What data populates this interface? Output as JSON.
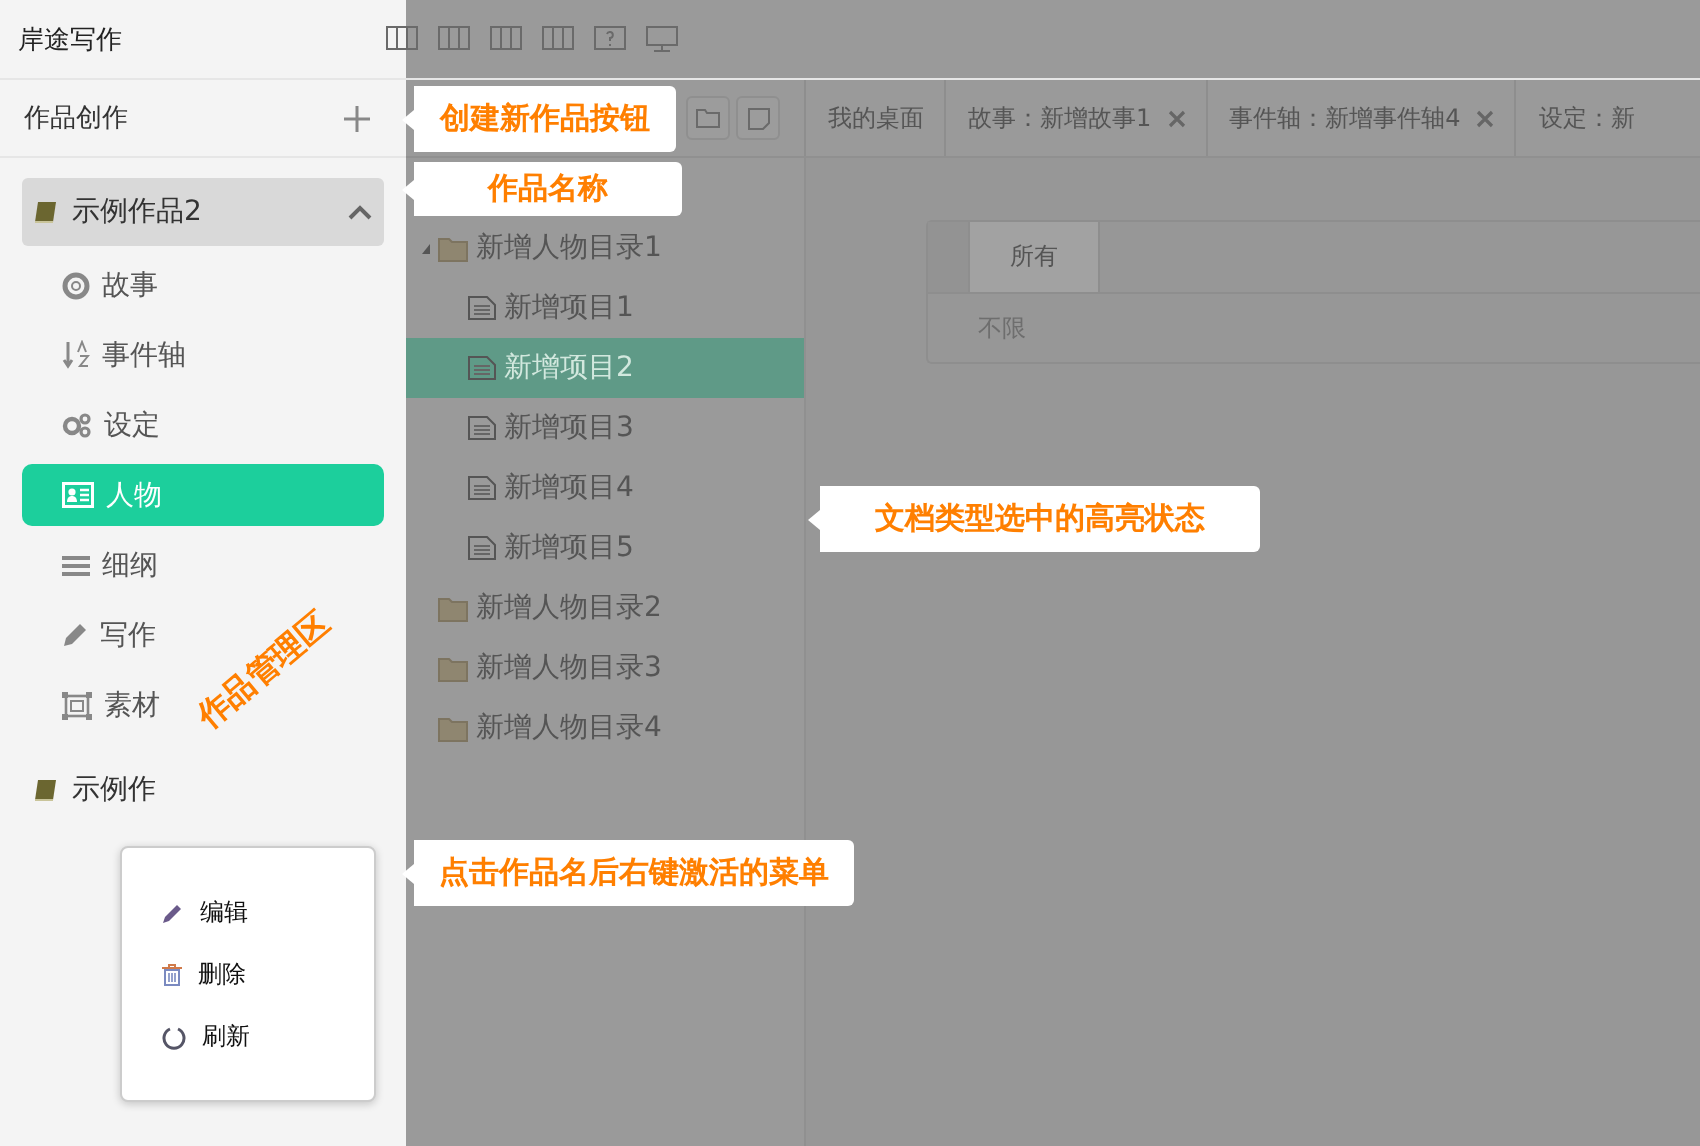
{
  "app": {
    "title": "岸途写作"
  },
  "sidebar": {
    "header": "作品创作",
    "works": [
      {
        "name": "示例作品2",
        "expanded": true,
        "doc_types": [
          {
            "label": "故事",
            "kind": "story",
            "selected": false
          },
          {
            "label": "事件轴",
            "kind": "timeline",
            "selected": false
          },
          {
            "label": "设定",
            "kind": "setting",
            "selected": false
          },
          {
            "label": "人物",
            "kind": "character",
            "selected": true
          },
          {
            "label": "细纲",
            "kind": "outline",
            "selected": false
          },
          {
            "label": "写作",
            "kind": "writing",
            "selected": false
          },
          {
            "label": "素材",
            "kind": "material",
            "selected": false
          }
        ]
      },
      {
        "name": "示例作",
        "expanded": false
      }
    ]
  },
  "tree": {
    "items": [
      {
        "label": "新增人物目录1",
        "expanded": true,
        "children": [
          {
            "label": "新增项目1",
            "selected": false
          },
          {
            "label": "新增项目2",
            "selected": true
          },
          {
            "label": "新增项目3",
            "selected": false
          },
          {
            "label": "新增项目4",
            "selected": false
          },
          {
            "label": "新增项目5",
            "selected": false
          }
        ]
      },
      {
        "label": "新增人物目录2",
        "expanded": false
      },
      {
        "label": "新增人物目录3",
        "expanded": false
      },
      {
        "label": "新增人物目录4",
        "expanded": false
      }
    ]
  },
  "tabs": [
    {
      "label": "我的桌面",
      "closable": false
    },
    {
      "label": "故事：新增故事1",
      "closable": true
    },
    {
      "label": "事件轴：新增事件轴4",
      "closable": true
    },
    {
      "label": "设定：新",
      "closable": false
    }
  ],
  "panel": {
    "filter_tabs": [
      {
        "label": "所有",
        "selected": true
      }
    ],
    "filter_value": "不限"
  },
  "context_menu": [
    {
      "label": "编辑",
      "kind": "edit"
    },
    {
      "label": "删除",
      "kind": "delete"
    },
    {
      "label": "刷新",
      "kind": "refresh"
    }
  ],
  "callouts": [
    "创建新作品按钮",
    "作品名称",
    "文档类型选中的高亮状态",
    "点击作品名后右键激活的菜单"
  ],
  "area_label": "作品管理区"
}
